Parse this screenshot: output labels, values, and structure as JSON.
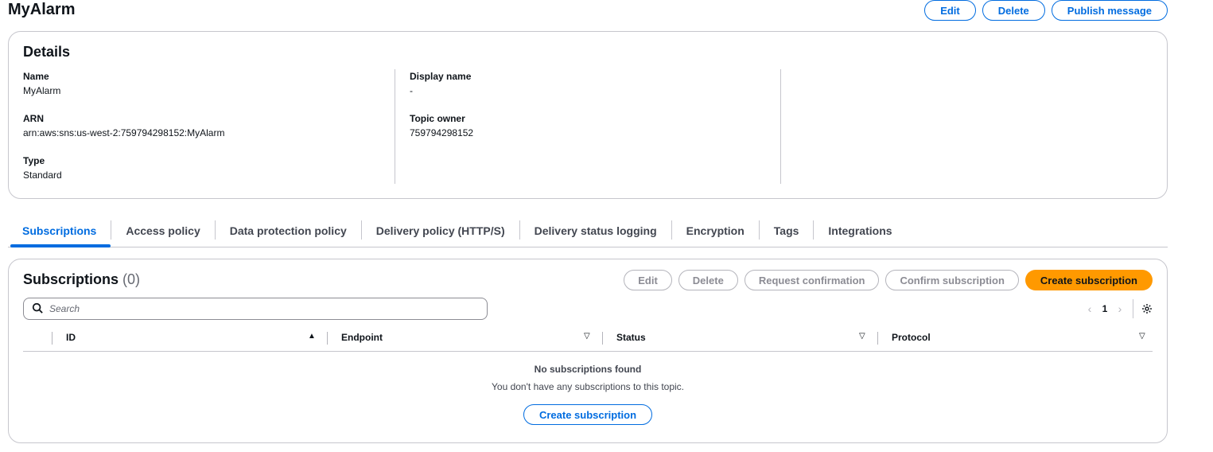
{
  "page": {
    "title": "MyAlarm",
    "actions": {
      "edit": "Edit",
      "delete": "Delete",
      "publish": "Publish message"
    }
  },
  "details": {
    "title": "Details",
    "name_label": "Name",
    "name_value": "MyAlarm",
    "arn_label": "ARN",
    "arn_value": "arn:aws:sns:us-west-2:759794298152:MyAlarm",
    "type_label": "Type",
    "type_value": "Standard",
    "display_name_label": "Display name",
    "display_name_value": "-",
    "topic_owner_label": "Topic owner",
    "topic_owner_value": "759794298152"
  },
  "tabs": [
    {
      "label": "Subscriptions",
      "active": true
    },
    {
      "label": "Access policy"
    },
    {
      "label": "Data protection policy"
    },
    {
      "label": "Delivery policy (HTTP/S)"
    },
    {
      "label": "Delivery status logging"
    },
    {
      "label": "Encryption"
    },
    {
      "label": "Tags"
    },
    {
      "label": "Integrations"
    }
  ],
  "subscriptions": {
    "title": "Subscriptions",
    "count": "(0)",
    "actions": {
      "edit": "Edit",
      "delete": "Delete",
      "request_confirmation": "Request confirmation",
      "confirm_subscription": "Confirm subscription",
      "create": "Create subscription"
    },
    "search_placeholder": "Search",
    "pagination": {
      "current_page": "1"
    },
    "columns": [
      "ID",
      "Endpoint",
      "Status",
      "Protocol"
    ],
    "empty_title": "No subscriptions found",
    "empty_desc": "You don't have any subscriptions to this topic.",
    "empty_action": "Create subscription"
  },
  "colors": {
    "accent": "#006ce0",
    "primary_button": "#ff9900",
    "border": "#c6c6cd"
  }
}
